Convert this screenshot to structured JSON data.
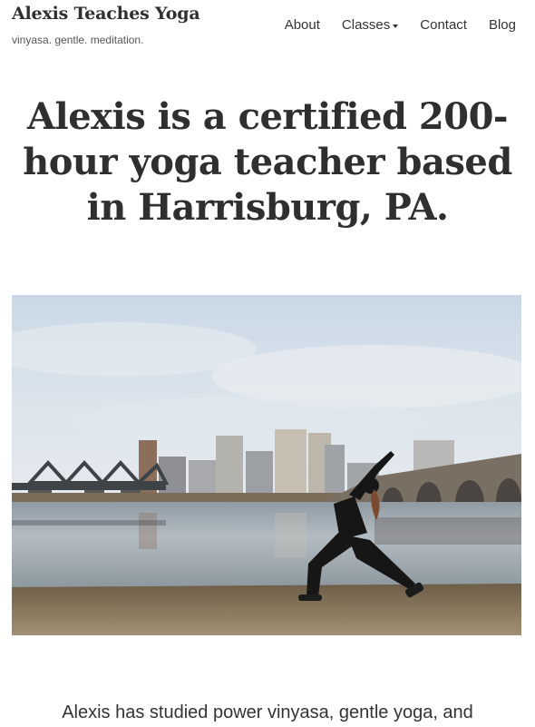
{
  "header": {
    "site_title": "Alexis Teaches Yoga",
    "tagline": "vinyasa. gentle. meditation.",
    "nav": {
      "about": "About",
      "classes": "Classes",
      "contact": "Contact",
      "blog": "Blog"
    }
  },
  "hero": {
    "heading": "Alexis is a certified 200-hour yoga teacher based in Harrisburg, PA."
  },
  "intro": {
    "text": "Alexis has studied power vinyasa, gentle yoga, and"
  },
  "colors": {
    "text": "#333333",
    "heading": "#2f2f2f",
    "sky": "#d7e2ec",
    "water": "#9aa4ab",
    "grass": "#8a7a60"
  }
}
